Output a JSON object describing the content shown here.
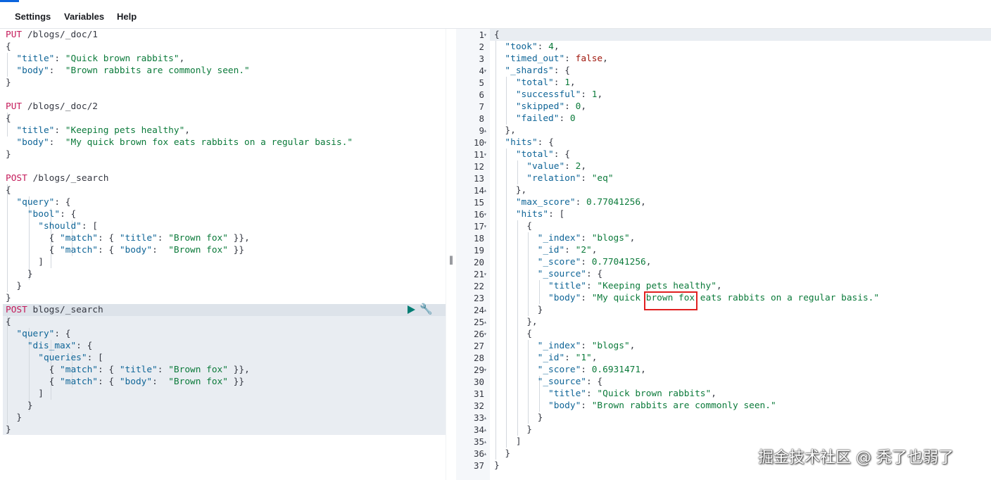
{
  "menu": {
    "settings": "Settings",
    "variables": "Variables",
    "help": "Help"
  },
  "divider_grip": "||",
  "watermark": "掘金技术社区 @ 秃了也弱了",
  "icons": {
    "run": "play-triangle-icon",
    "settings": "wrench-icon"
  },
  "colors": {
    "accent": "#0b64dd",
    "method": "#c41a5a",
    "key": "#0f6597",
    "string": "#0b7a3a",
    "boolean": "#a0180e",
    "highlight_box": "#e02020"
  },
  "request_lines": [
    "PUT /blogs/_doc/1",
    "{",
    "  \"title\": \"Quick brown rabbits\",",
    "  \"body\":  \"Brown rabbits are commonly seen.\"",
    "}",
    "",
    "PUT /blogs/_doc/2",
    "{",
    "  \"title\": \"Keeping pets healthy\",",
    "  \"body\":  \"My quick brown fox eats rabbits on a regular basis.\"",
    "}",
    "",
    "POST /blogs/_search",
    "{",
    "  \"query\": {",
    "    \"bool\": {",
    "      \"should\": [",
    "        { \"match\": { \"title\": \"Brown fox\" }},",
    "        { \"match\": { \"body\":  \"Brown fox\" }}",
    "      ]",
    "    }",
    "  }",
    "}",
    "POST blogs/_search",
    "{",
    "  \"query\": {",
    "    \"dis_max\": {",
    "      \"queries\": [",
    "        { \"match\": { \"title\": \"Brown fox\" }},",
    "        { \"match\": { \"body\":  \"Brown fox\" }}",
    "      ]",
    "    }",
    "  }",
    "}"
  ],
  "response_lines": [
    "{",
    "  \"took\": 4,",
    "  \"timed_out\": false,",
    "  \"_shards\": {",
    "    \"total\": 1,",
    "    \"successful\": 1,",
    "    \"skipped\": 0,",
    "    \"failed\": 0",
    "  },",
    "  \"hits\": {",
    "    \"total\": {",
    "      \"value\": 2,",
    "      \"relation\": \"eq\"",
    "    },",
    "    \"max_score\": 0.77041256,",
    "    \"hits\": [",
    "      {",
    "        \"_index\": \"blogs\",",
    "        \"_id\": \"2\",",
    "        \"_score\": 0.77041256,",
    "        \"_source\": {",
    "          \"title\": \"Keeping pets healthy\",",
    "          \"body\": \"My quick brown fox eats rabbits on a regular basis.\"",
    "        }",
    "      },",
    "      {",
    "        \"_index\": \"blogs\",",
    "        \"_id\": \"1\",",
    "        \"_score\": 0.6931471,",
    "        \"_source\": {",
    "          \"title\": \"Quick brown rabbits\",",
    "          \"body\": \"Brown rabbits are commonly seen.\"",
    "        }",
    "      }",
    "    ]",
    "  }",
    "}"
  ],
  "fold_markers": {
    "open": "▾",
    "close": "▴"
  }
}
